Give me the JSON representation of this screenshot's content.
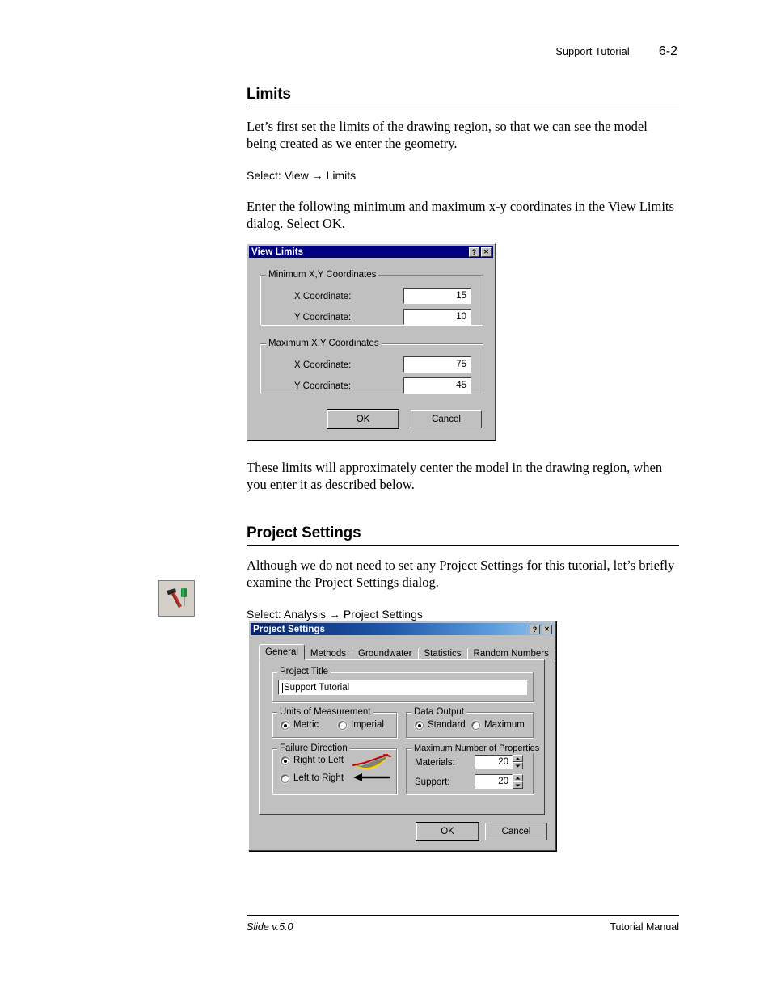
{
  "header": {
    "title": "Support Tutorial",
    "page_number": "6-2"
  },
  "sections": [
    {
      "heading": "Limits",
      "paragraph1": "Let’s first set the limits of the drawing region, so that we can see the model being created as we enter the geometry.",
      "select_line": "Select: View → Limits",
      "paragraph2": "Enter the following minimum and maximum x-y coordinates in the View Limits dialog. Select OK.",
      "paragraph3": "These limits will approximately center the model in the drawing region, when you enter it as described below."
    },
    {
      "heading": "Project Settings",
      "paragraph1": "Although we do not need to set any Project Settings for this tutorial, let’s briefly examine the Project Settings dialog.",
      "select_line": "Select: Analysis → Project Settings"
    }
  ],
  "margin_icon": {
    "name": "project-settings-toolbar-icon",
    "description": "hammer and screwdriver"
  },
  "view_limits_dialog": {
    "title": "View Limits",
    "help_button": "?",
    "close_button": "✕",
    "groups": [
      {
        "label": "Minimum X,Y Coordinates",
        "fields": [
          {
            "label": "X Coordinate:",
            "value": "15"
          },
          {
            "label": "Y Coordinate:",
            "value": "10"
          }
        ]
      },
      {
        "label": "Maximum X,Y Coordinates",
        "fields": [
          {
            "label": "X Coordinate:",
            "value": "75"
          },
          {
            "label": "Y Coordinate:",
            "value": "45"
          }
        ]
      }
    ],
    "ok_label": "OK",
    "cancel_label": "Cancel"
  },
  "project_settings_dialog": {
    "title": "Project Settings",
    "help_button": "?",
    "close_button": "✕",
    "tabs": [
      {
        "label": "General",
        "active": true
      },
      {
        "label": "Methods",
        "active": false
      },
      {
        "label": "Groundwater",
        "active": false
      },
      {
        "label": "Statistics",
        "active": false
      },
      {
        "label": "Random Numbers",
        "active": false
      }
    ],
    "project_title": {
      "group_label": "Project Title",
      "value": "Support Tutorial"
    },
    "units_of_measurement": {
      "group_label": "Units of Measurement",
      "options": [
        {
          "label": "Metric",
          "selected": true
        },
        {
          "label": "Imperial",
          "selected": false
        }
      ]
    },
    "data_output": {
      "group_label": "Data Output",
      "options": [
        {
          "label": "Standard",
          "selected": true
        },
        {
          "label": "Maximum",
          "selected": false
        }
      ]
    },
    "failure_direction": {
      "group_label": "Failure Direction",
      "options": [
        {
          "label": "Right to Left",
          "selected": true
        },
        {
          "label": "Left to Right",
          "selected": false
        }
      ],
      "diagram_colors": {
        "slope": "#c00000",
        "wedge": "#808080",
        "arc": "#ffd700"
      }
    },
    "maximum_number_of_properties": {
      "group_label": "Maximum Number of Properties",
      "fields": [
        {
          "label": "Materials:",
          "value": "20"
        },
        {
          "label": "Support:",
          "value": "20"
        }
      ]
    },
    "ok_label": "OK",
    "cancel_label": "Cancel"
  },
  "footer": {
    "left": "Slide v.5.0",
    "right": "Tutorial Manual"
  }
}
